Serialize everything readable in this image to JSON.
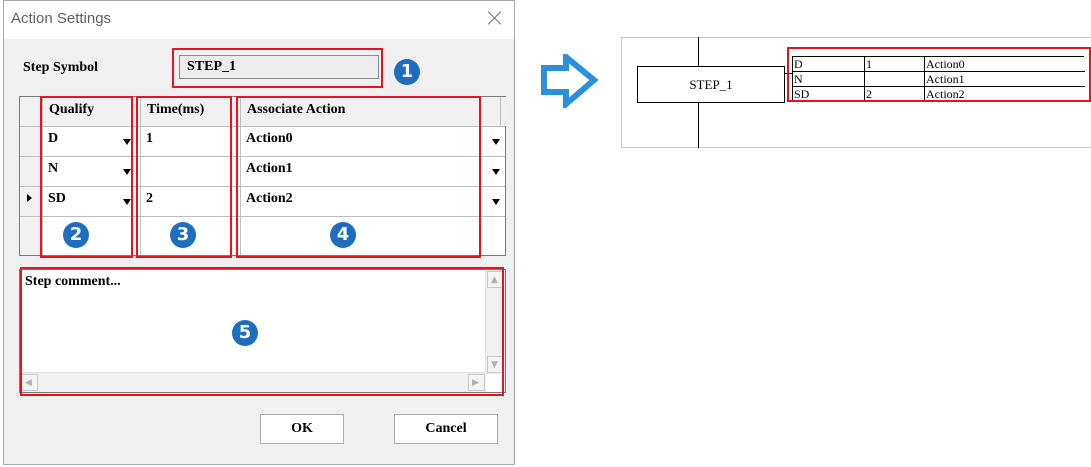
{
  "dialog": {
    "title": "Action Settings",
    "step_symbol_label": "Step Symbol",
    "step_symbol_value": "STEP_1",
    "grid": {
      "headers": [
        "Qualify",
        "Time(ms)",
        "Associate Action"
      ],
      "rows": [
        {
          "qualify": "D",
          "time": "1",
          "action": "Action0",
          "current": false
        },
        {
          "qualify": "N",
          "time": "",
          "action": "Action1",
          "current": false
        },
        {
          "qualify": "SD",
          "time": "2",
          "action": "Action2",
          "current": true
        }
      ]
    },
    "comment": "Step comment...",
    "ok_label": "OK",
    "cancel_label": "Cancel"
  },
  "badges": [
    "1",
    "2",
    "3",
    "4",
    "5"
  ],
  "diagram": {
    "step_name": "STEP_1",
    "actions": [
      {
        "qualify": "D",
        "time": "1",
        "action": "Action0"
      },
      {
        "qualify": "N",
        "time": "",
        "action": "Action1"
      },
      {
        "qualify": "SD",
        "time": "2",
        "action": "Action2"
      }
    ]
  },
  "colors": {
    "highlight": "#e8131c",
    "badge": "#1f6dbf",
    "arrow_fill": "#ffffff",
    "arrow_stroke": "#2b90d9"
  }
}
